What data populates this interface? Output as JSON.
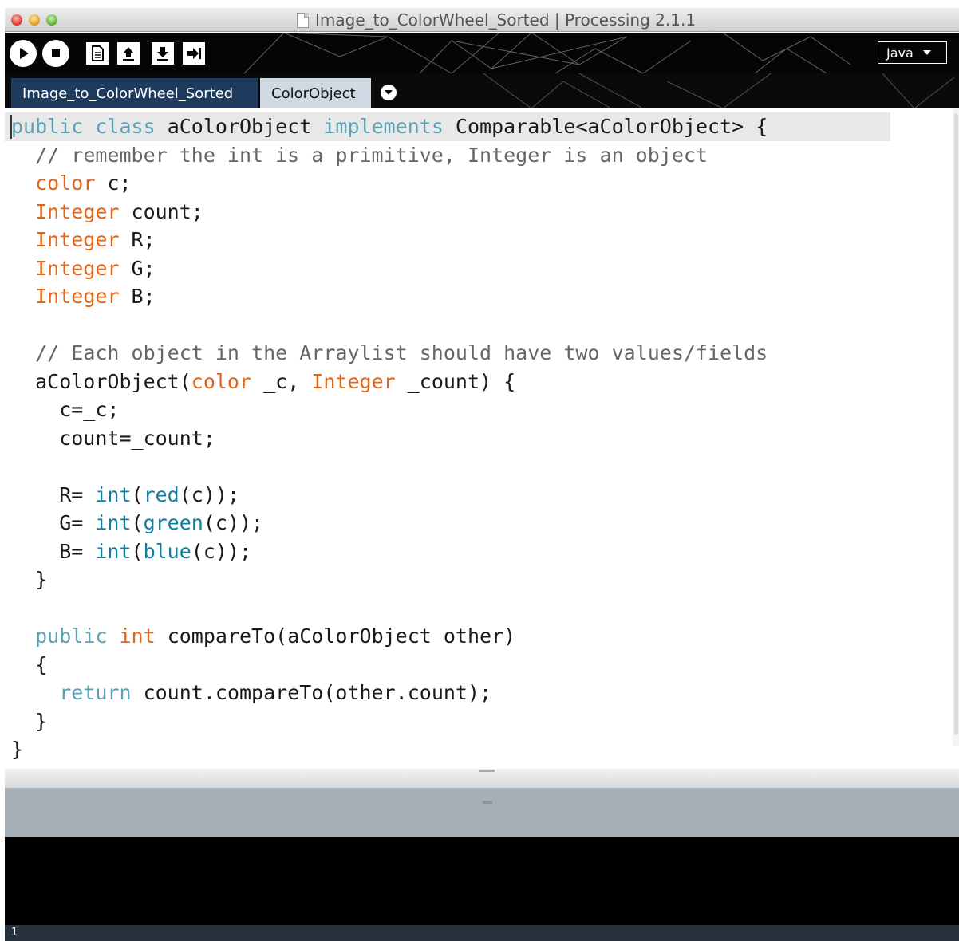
{
  "window": {
    "title": "Image_to_ColorWheel_Sorted | Processing 2.1.1"
  },
  "toolbar": {
    "buttons": [
      {
        "name": "run",
        "icon": "play-icon"
      },
      {
        "name": "stop",
        "icon": "stop-icon"
      },
      {
        "name": "new",
        "icon": "new-file-icon"
      },
      {
        "name": "open",
        "icon": "open-arrow-up-icon"
      },
      {
        "name": "save",
        "icon": "save-arrow-down-icon"
      },
      {
        "name": "export",
        "icon": "export-arrow-right-icon"
      }
    ],
    "mode": "Java"
  },
  "tabs": [
    {
      "label": "Image_to_ColorWheel_Sorted",
      "active": false
    },
    {
      "label": "ColorObject",
      "active": true
    }
  ],
  "editor": {
    "lines": [
      "public class aColorObject implements Comparable<aColorObject> {",
      "  // remember the int is a primitive, Integer is an object",
      "  color c;",
      "  Integer count;",
      "  Integer R;",
      "  Integer G;",
      "  Integer B;",
      "",
      "  // Each object in the Arraylist should have two values/fields",
      "  aColorObject(color _c, Integer _count) {",
      "    c=_c;",
      "    count=_count;",
      "",
      "    R= int(red(c));",
      "    G= int(green(c));",
      "    B= int(blue(c));",
      "  }",
      "",
      "  public int compareTo(aColorObject other)",
      "  {",
      "    return count.compareTo(other.count);",
      "  }",
      "}"
    ]
  },
  "status": {
    "line_number": "1"
  },
  "colors": {
    "keyword": "#5aa1b5",
    "type": "#e2661a",
    "function": "#0f7da0",
    "comment": "#666666",
    "tab_active": "#cfd8e3",
    "tab_inactive": "#1e3a5c"
  }
}
